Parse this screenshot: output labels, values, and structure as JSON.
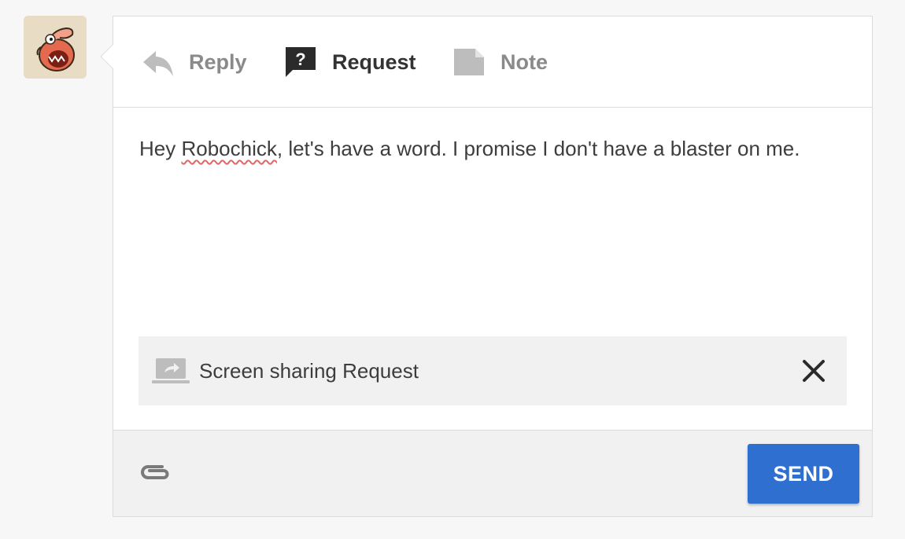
{
  "tabs": [
    {
      "label": "Reply",
      "icon": "reply-icon",
      "active": false
    },
    {
      "label": "Request",
      "icon": "question-bubble-icon",
      "active": true
    },
    {
      "label": "Note",
      "icon": "note-icon",
      "active": false
    }
  ],
  "editor": {
    "text_before": "Hey ",
    "misspelled_word": "Robochick",
    "text_after": ", let's have a word. I promise I don't have a blaster on me."
  },
  "attachment": {
    "label": "Screen sharing Request",
    "icon": "screen-share-icon",
    "close_icon": "close-icon"
  },
  "footer": {
    "attach_icon": "paperclip-icon",
    "send_label": "SEND"
  },
  "colors": {
    "accent": "#2f6fcf",
    "active_tab": "#333333",
    "inactive_tab": "#8a8a8a",
    "panel_bg": "#f1f1f1"
  }
}
